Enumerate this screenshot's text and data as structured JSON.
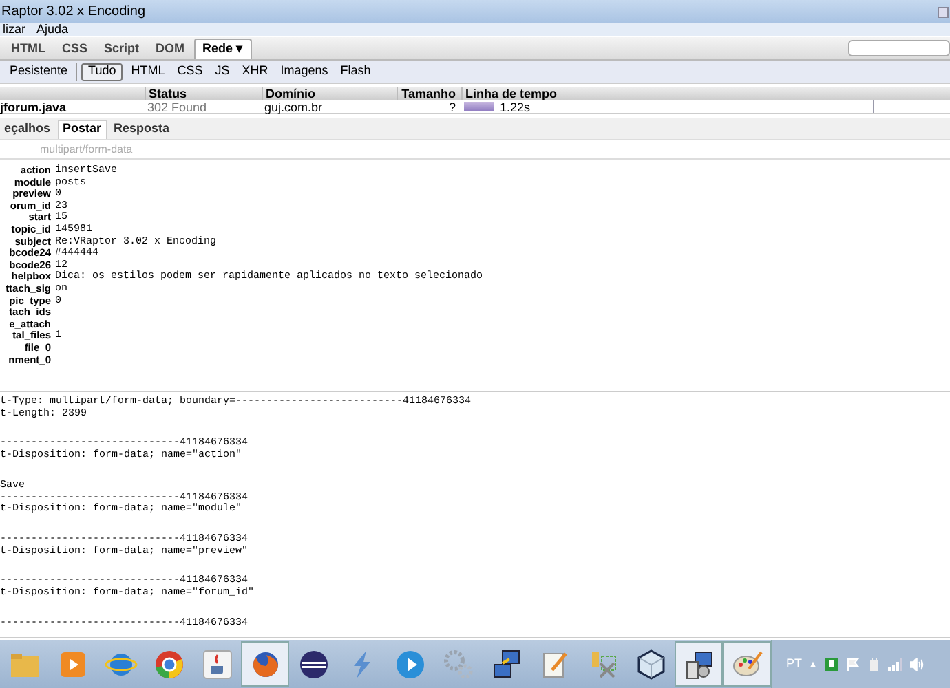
{
  "window": {
    "title": "Raptor 3.02 x Encoding"
  },
  "menu": [
    "lizar",
    "Ajuda"
  ],
  "panel_tabs": [
    {
      "label": "HTML",
      "selected": false
    },
    {
      "label": "CSS",
      "selected": false
    },
    {
      "label": "Script",
      "selected": false
    },
    {
      "label": "DOM",
      "selected": false
    },
    {
      "label": "Rede ▾",
      "selected": true
    }
  ],
  "filters": [
    {
      "label": "Pesistente",
      "selected": false
    },
    {
      "label": "Tudo",
      "selected": true
    },
    {
      "label": "HTML",
      "selected": false
    },
    {
      "label": "CSS",
      "selected": false
    },
    {
      "label": "JS",
      "selected": false
    },
    {
      "label": "XHR",
      "selected": false
    },
    {
      "label": "Imagens",
      "selected": false
    },
    {
      "label": "Flash",
      "selected": false
    }
  ],
  "table": {
    "columns": [
      "Status",
      "Domínio",
      "Tamanho",
      "Linha de tempo"
    ],
    "rows": [
      {
        "file": "jforum.java",
        "status": "302 Found",
        "domain": "guj.com.br",
        "size": "?",
        "time": "1.22s"
      }
    ]
  },
  "detail_tabs": [
    {
      "label": "eçalhos",
      "selected": false
    },
    {
      "label": "Postar",
      "selected": true
    },
    {
      "label": "Resposta",
      "selected": false
    }
  ],
  "content_type": "multipart/form-data",
  "params": [
    {
      "name": "action",
      "value": "insertSave"
    },
    {
      "name": "module",
      "value": "posts"
    },
    {
      "name": "preview",
      "value": "0"
    },
    {
      "name": "orum_id",
      "value": "23"
    },
    {
      "name": "start",
      "value": "15"
    },
    {
      "name": "topic_id",
      "value": "145981"
    },
    {
      "name": "subject",
      "value": "Re:VRaptor 3.02 x Encoding"
    },
    {
      "name": "bcode24",
      "value": "#444444"
    },
    {
      "name": "bcode26",
      "value": "12"
    },
    {
      "name": "helpbox",
      "value": "Dica: os estilos podem ser rapidamente aplicados no texto selecionado"
    },
    {
      "name": "ttach_sig",
      "value": "on"
    },
    {
      "name": "pic_type",
      "value": "0"
    },
    {
      "name": "tach_ids"
    },
    {
      "name": "e_attach"
    },
    {
      "name": "tal_files",
      "value": "1"
    },
    {
      "name": "file_0"
    },
    {
      "name": "nment_0"
    }
  ],
  "source_blocks": [
    [
      "t-Type: multipart/form-data; boundary=---------------------------41184676334",
      "t-Length: 2399"
    ],
    [
      "-----------------------------41184676334",
      "t-Disposition: form-data; name=\"action\""
    ],
    [
      "Save",
      "-----------------------------41184676334",
      "t-Disposition: form-data; name=\"module\""
    ],
    [
      "-----------------------------41184676334",
      "t-Disposition: form-data; name=\"preview\""
    ],
    [
      "-----------------------------41184676334",
      "t-Disposition: form-data; name=\"forum_id\""
    ],
    [
      "-----------------------------41184676334"
    ]
  ],
  "taskbar": [
    {
      "kind": "folder",
      "highlighted": false
    },
    {
      "kind": "player",
      "highlighted": false
    },
    {
      "kind": "ie",
      "highlighted": false
    },
    {
      "kind": "chrome",
      "highlighted": false
    },
    {
      "kind": "java",
      "highlighted": false
    },
    {
      "kind": "firefox",
      "highlighted": true
    },
    {
      "kind": "eclipse",
      "highlighted": false
    },
    {
      "kind": "bolt",
      "highlighted": false
    },
    {
      "kind": "play",
      "highlighted": false
    },
    {
      "kind": "gears",
      "highlighted": false
    },
    {
      "kind": "network",
      "highlighted": false
    },
    {
      "kind": "notepad",
      "highlighted": false
    },
    {
      "kind": "tools",
      "highlighted": false
    },
    {
      "kind": "cube",
      "highlighted": false
    },
    {
      "kind": "installer",
      "highlighted": true
    },
    {
      "kind": "palette",
      "highlighted": true
    }
  ],
  "tray": {
    "language": "PT",
    "expand": "▴"
  }
}
